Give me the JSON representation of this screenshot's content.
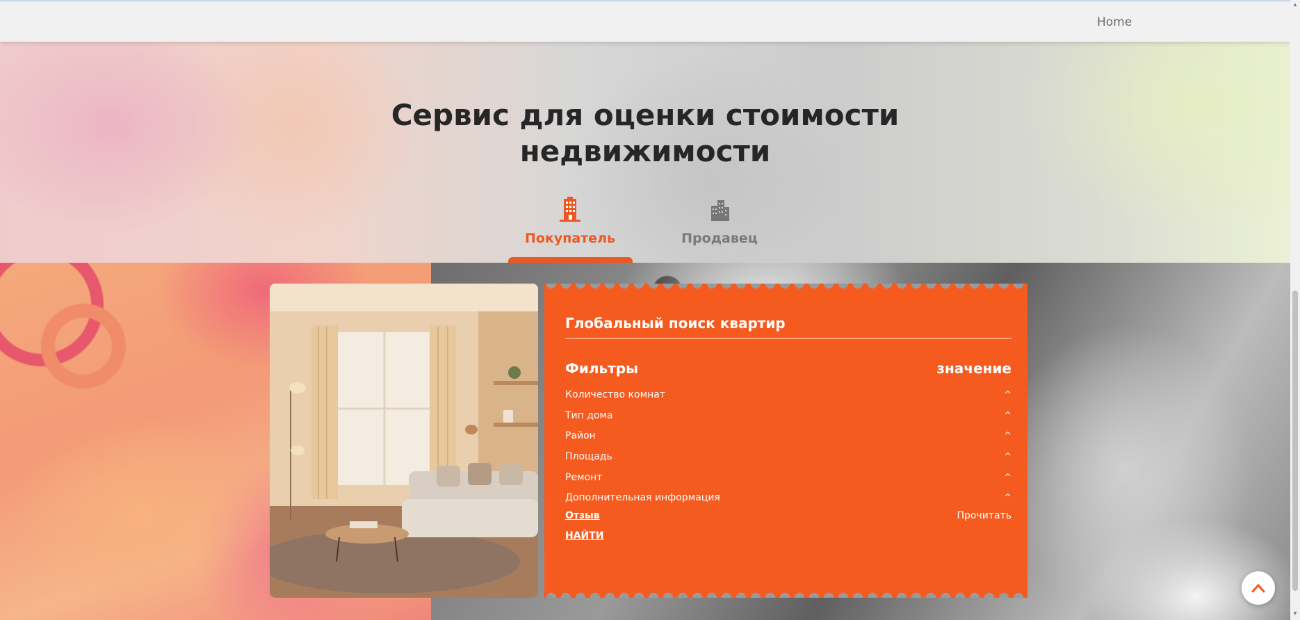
{
  "header": {
    "nav_home": "Home"
  },
  "hero": {
    "title_line1": "Сервис для оценки стоимости",
    "title_line2": "недвижимости"
  },
  "tabs": [
    {
      "label": "Покупатель",
      "icon": "buyer-building-icon",
      "active": true
    },
    {
      "label": "Продавец",
      "icon": "seller-building-icon",
      "active": false
    }
  ],
  "search_card": {
    "title": "Глобальный поиск квартир",
    "filters_header": "Фильтры",
    "value_header": "значение",
    "filters": [
      {
        "label": "Количество комнат",
        "caret": "^"
      },
      {
        "label": "Тип дома",
        "caret": "^"
      },
      {
        "label": "Район",
        "caret": "^"
      },
      {
        "label": "Площадь",
        "caret": "^"
      },
      {
        "label": "Ремонт",
        "caret": "^"
      },
      {
        "label": "Дополнительная информация",
        "caret": "^"
      }
    ],
    "review_label": "Отзыв",
    "read_label": "Прочитать",
    "find_label": "НАЙТИ"
  },
  "colors": {
    "accent": "#f55a1e",
    "title": "#262626",
    "inactive_tab": "#7a7a7a"
  }
}
